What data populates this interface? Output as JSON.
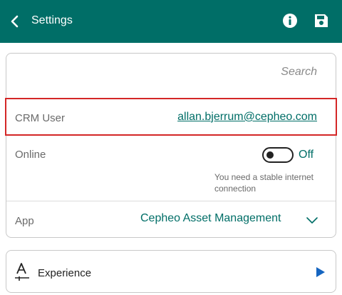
{
  "header": {
    "title": "Settings",
    "background": "#006e67"
  },
  "settings": {
    "search_placeholder": "Search",
    "crm_user_label": "CRM User",
    "crm_user_value": "allan.bjerrum@cepheo.com",
    "online_label": "Online",
    "online_state": "Off",
    "online_hint": "You need a stable internet connection",
    "app_label": "App",
    "app_value": "Cepheo Asset Management"
  },
  "experience": {
    "label": "Experience"
  },
  "colors": {
    "accent": "#006e67",
    "highlight_border": "#d42727",
    "play": "#1565c0"
  }
}
